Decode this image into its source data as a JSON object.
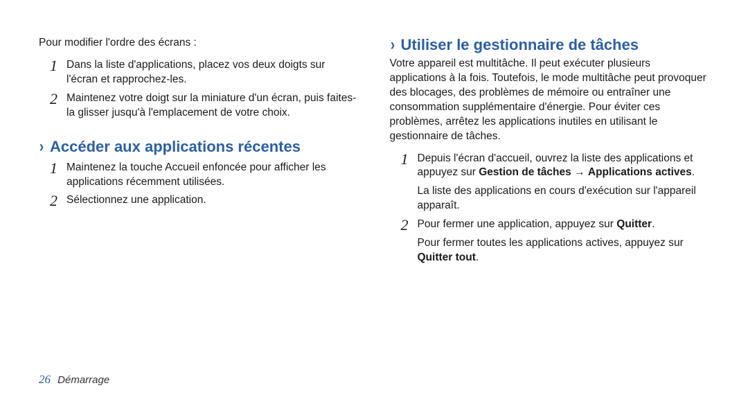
{
  "left": {
    "intro": "Pour modifier l'ordre des écrans :",
    "steps": [
      {
        "num": "1",
        "text": "Dans la liste d'applications, placez vos deux doigts sur l'écran et rapprochez-les."
      },
      {
        "num": "2",
        "text": "Maintenez votre doigt sur la miniature d'un écran, puis faites-la glisser jusqu'à l'emplacement de votre choix."
      }
    ],
    "section_title": "Accéder aux applications récentes",
    "section_steps": [
      {
        "num": "1",
        "text": "Maintenez la touche Accueil enfoncée pour afficher les applications récemment utilisées."
      },
      {
        "num": "2",
        "text": "Sélectionnez une application."
      }
    ]
  },
  "right": {
    "section_title": "Utiliser le gestionnaire de tâches",
    "intro": "Votre appareil est multitâche. Il peut exécuter plusieurs applications à la fois. Toutefois, le mode multitâche peut provoquer des blocages, des problèmes de mémoire ou entraîner une consommation supplémentaire d'énergie. Pour éviter ces problèmes, arrêtez les applications inutiles en utilisant le gestionnaire de tâches.",
    "step1_num": "1",
    "step1_part1": "Depuis l'écran d'accueil, ouvrez la liste des applications et appuyez sur ",
    "step1_bold1": "Gestion de tâches",
    "step1_arrow": " → ",
    "step1_bold2": "Applications actives",
    "step1_suffix": ".",
    "step1_sub": "La liste des applications en cours d'exécution sur l'appareil apparaît.",
    "step2_num": "2",
    "step2_part1": "Pour fermer une application, appuyez sur ",
    "step2_bold1": "Quitter",
    "step2_suffix": ".",
    "step2_sub_part1": "Pour fermer toutes les applications actives, appuyez sur ",
    "step2_sub_bold": "Quitter tout",
    "step2_sub_suffix": "."
  },
  "footer": {
    "page": "26",
    "label": "Démarrage"
  },
  "chevron": "›"
}
